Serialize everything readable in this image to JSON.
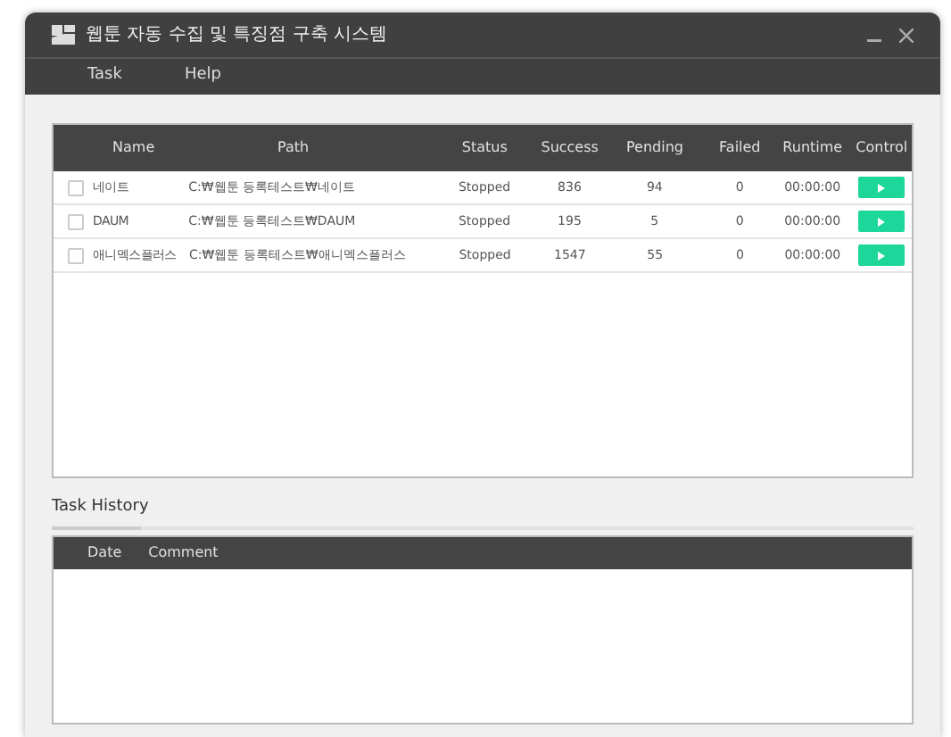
{
  "window": {
    "title": "웹툰 자동 수집 및 특징점 구축 시스템"
  },
  "menu": [
    "Task",
    "Help"
  ],
  "tasks": {
    "columns": [
      "Name",
      "Path",
      "Status",
      "Success",
      "Pending",
      "Failed",
      "Runtime",
      "Control"
    ],
    "rows": [
      {
        "checked": false,
        "name": "네이트",
        "path": "C:₩웹툰 등록테스트₩네이트",
        "status": "Stopped",
        "success": "836",
        "pending": "94",
        "failed": "0",
        "runtime": "00:00:00"
      },
      {
        "checked": false,
        "name": "DAUM",
        "path": "C:₩웹툰 등록테스트₩DAUM",
        "status": "Stopped",
        "success": "195",
        "pending": "5",
        "failed": "0",
        "runtime": "00:00:00"
      },
      {
        "checked": false,
        "name": "애니멕스플러스",
        "path": "C:₩웹툰 등록테스트₩애니멕스플러스",
        "status": "Stopped",
        "success": "1547",
        "pending": "55",
        "failed": "0",
        "runtime": "00:00:00"
      }
    ]
  },
  "history": {
    "title": "Task History",
    "columns": [
      "Date",
      "Comment"
    ]
  }
}
